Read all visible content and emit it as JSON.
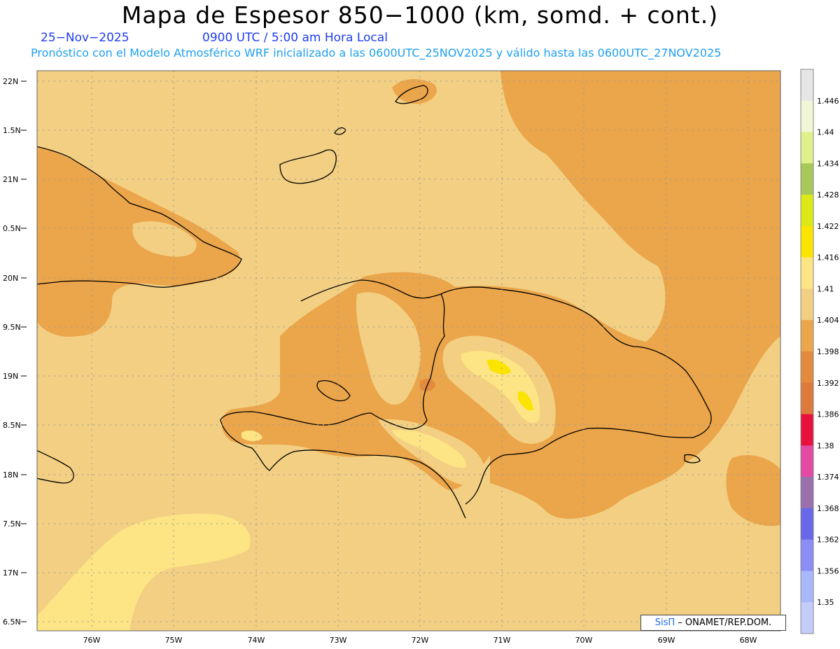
{
  "header": {
    "title": "Mapa de Espesor 850−1000 (km, somd. + cont.)",
    "date": "25−Nov−2025",
    "time": "0900 UTC / 5:00 am Hora Local",
    "forecast_info": "Pronóstico con el Modelo Atmosférico WRF inicializado a las 0600UTC_25NOV2025 y válido hasta las  0600UTC_27NOV2025"
  },
  "map": {
    "lat_labels": [
      "22N",
      "1.5N",
      "21N",
      "0.5N",
      "20N",
      "9.5N",
      "19N",
      "8.5N",
      "18N",
      "7.5N",
      "17N",
      "6.5N"
    ],
    "lon_labels": [
      "76W",
      "75W",
      "74W",
      "73W",
      "72W",
      "71W",
      "70W",
      "69W",
      "68W"
    ],
    "fill_colors": {
      "ocean_base": "#f2cf82",
      "band_1398": "#eba54a",
      "band_1392": "#e38a3c",
      "band_1410": "#fde585",
      "band_1416": "#fbe400",
      "coast": "#000000"
    }
  },
  "colorbar": {
    "labels": [
      "1.446",
      "1.44",
      "1.434",
      "1.428",
      "1.422",
      "1.416",
      "1.41",
      "1.404",
      "1.398",
      "1.392",
      "1.386",
      "1.38",
      "1.374",
      "1.368",
      "1.362",
      "1.356",
      "1.35"
    ],
    "colors": [
      "#e6e6e6",
      "#f0f6d6",
      "#e0f08c",
      "#a8c85a",
      "#dce818",
      "#fbe400",
      "#fde585",
      "#f2cf82",
      "#eba54a",
      "#e38a3c",
      "#dd7a3c",
      "#e8103c",
      "#e34aa4",
      "#9a70ac",
      "#6868e8",
      "#8c8cf6",
      "#a8b8fa",
      "#c4ccfa"
    ]
  },
  "credit": {
    "brand": "SisΠ",
    "text": " – ONAMET/REP.DOM."
  }
}
